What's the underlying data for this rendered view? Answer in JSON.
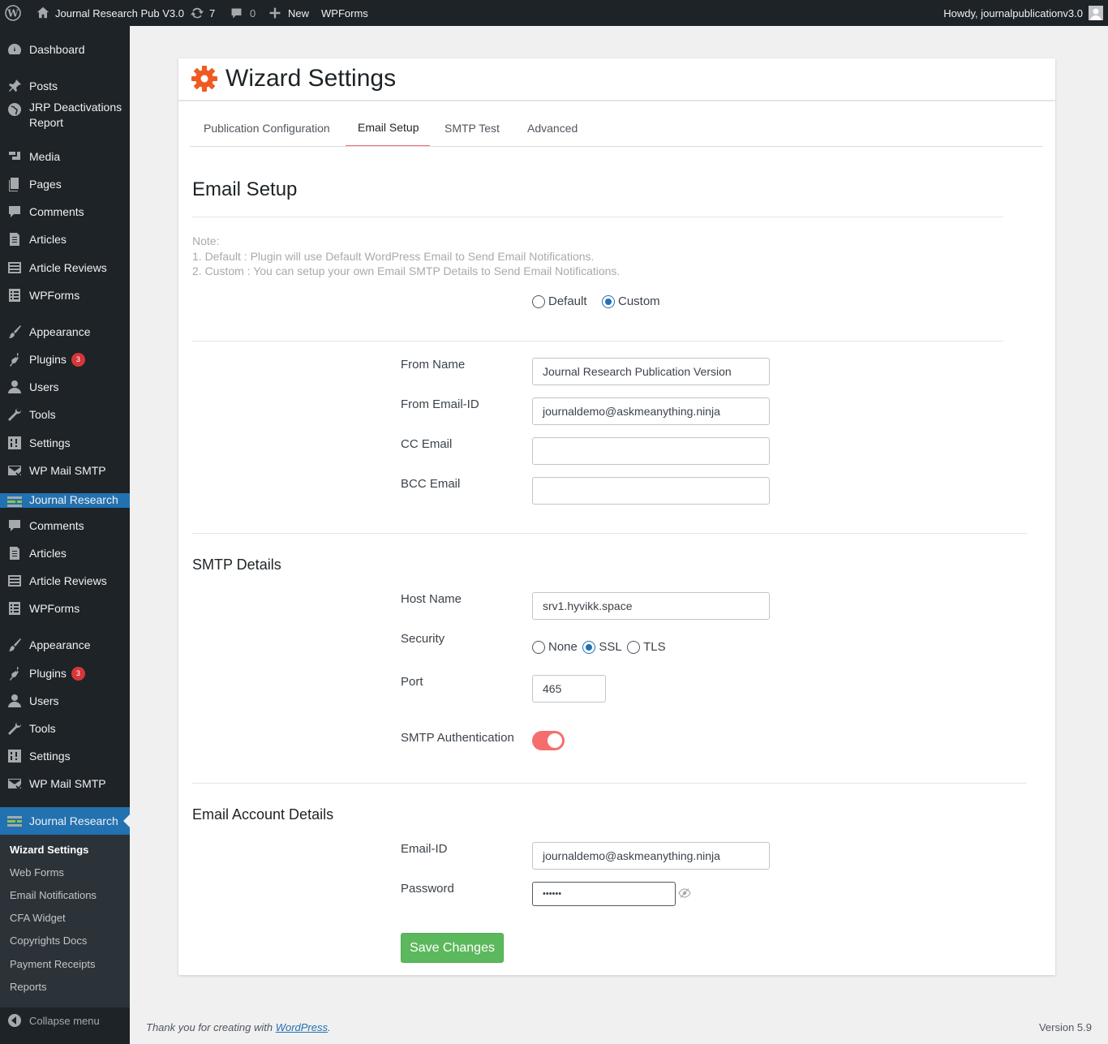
{
  "admin_bar": {
    "site_name": "Journal Research Pub V3.0",
    "updates_count": "7",
    "comments_count": "0",
    "new_label": "New",
    "wpforms_label": "WPForms",
    "howdy": "Howdy, journalpublicationv3.0"
  },
  "sidebar": {
    "items": [
      {
        "label": "Dashboard",
        "icon": "dashboard-icon"
      },
      {
        "label": "Posts",
        "icon": "pin-icon"
      },
      {
        "label": "JRP Deactivations Report",
        "icon": "globe-icon"
      },
      {
        "label": "Media",
        "icon": "media-icon"
      },
      {
        "label": "Pages",
        "icon": "page-icon"
      },
      {
        "label": "Comments",
        "icon": "comment-icon"
      },
      {
        "label": "Articles",
        "icon": "document-icon"
      },
      {
        "label": "Article Reviews",
        "icon": "list-icon"
      },
      {
        "label": "WPForms",
        "icon": "forms-icon"
      },
      {
        "label": "Appearance",
        "icon": "brush-icon"
      },
      {
        "label": "Plugins",
        "icon": "plugin-icon",
        "badge": "3"
      },
      {
        "label": "Users",
        "icon": "user-icon"
      },
      {
        "label": "Tools",
        "icon": "wrench-icon"
      },
      {
        "label": "Settings",
        "icon": "settings-icon"
      },
      {
        "label": "WP Mail SMTP",
        "icon": "mail-icon"
      },
      {
        "label": "Journal Research",
        "icon": "journal-icon"
      },
      {
        "label": "Comments",
        "icon": "comment-icon"
      },
      {
        "label": "Articles",
        "icon": "document-icon"
      },
      {
        "label": "Article Reviews",
        "icon": "list-icon"
      },
      {
        "label": "WPForms",
        "icon": "forms-icon"
      },
      {
        "label": "Appearance",
        "icon": "brush-icon"
      },
      {
        "label": "Plugins",
        "icon": "plugin-icon",
        "badge": "3"
      },
      {
        "label": "Users",
        "icon": "user-icon"
      },
      {
        "label": "Tools",
        "icon": "wrench-icon"
      },
      {
        "label": "Settings",
        "icon": "settings-icon"
      },
      {
        "label": "WP Mail SMTP",
        "icon": "mail-icon"
      },
      {
        "label": "Journal Research",
        "icon": "journal-icon"
      }
    ],
    "submenu": [
      "Wizard Settings",
      "Web Forms",
      "Email Notifications",
      "CFA Widget",
      "Copyrights Docs",
      "Payment Receipts",
      "Reports"
    ],
    "collapse_label": "Collapse menu"
  },
  "page": {
    "title": "Wizard Settings",
    "tabs": [
      "Publication Configuration",
      "Email Setup",
      "SMTP Test",
      "Advanced"
    ],
    "active_tab": "Email Setup",
    "section_title": "Email Setup",
    "note_lines": [
      "Note:",
      "1. Default : Plugin will use Default WordPress Email to Send Email Notifications.",
      "2. Custom : You can setup your own Email SMTP Details to Send Email Notifications."
    ],
    "mode_options": [
      "Default",
      "Custom"
    ],
    "mode_selected": "Custom",
    "from_name_label": "From Name",
    "from_name_value": "Journal Research Publication Version",
    "from_email_label": "From Email-ID",
    "from_email_value": "journaldemo@askmeanything.ninja",
    "cc_label": "CC Email",
    "cc_value": "",
    "bcc_label": "BCC Email",
    "bcc_value": "",
    "smtp_title": "SMTP Details",
    "host_label": "Host Name",
    "host_value": "srv1.hyvikk.space",
    "security_label": "Security",
    "security_options": [
      "None",
      "SSL",
      "TLS"
    ],
    "security_selected": "SSL",
    "port_label": "Port",
    "port_value": "465",
    "auth_label": "SMTP Authentication",
    "auth_on": true,
    "account_title": "Email Account Details",
    "email_label": "Email-ID",
    "email_value": "journaldemo@askmeanything.ninja",
    "password_label": "Password",
    "password_value": "••••••",
    "save_label": "Save Changes"
  },
  "footer": {
    "thanks_prefix": "Thank you for creating with ",
    "thanks_link": "WordPress",
    "thanks_suffix": ".",
    "version": "Version 5.9"
  },
  "colors": {
    "accent_red": "#f56e6e",
    "gear_orange": "#f05a22",
    "save_green": "#5cb85c",
    "wp_blue": "#2271b1"
  }
}
